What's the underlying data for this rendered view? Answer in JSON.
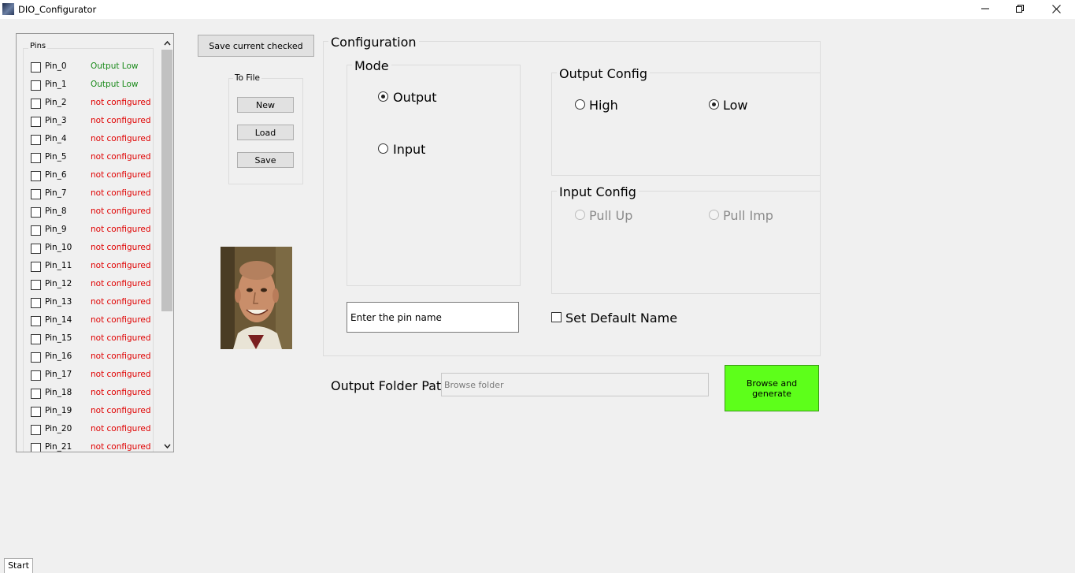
{
  "window": {
    "title": "DIO_Configurator",
    "minimize_glyph": "—",
    "maximize_icon": "restore-icon",
    "close_glyph": "✕"
  },
  "pins": {
    "legend": "Pins",
    "items": [
      {
        "name": "Pin_0",
        "status": "Output Low",
        "state": "ok"
      },
      {
        "name": "Pin_1",
        "status": "Output Low",
        "state": "ok"
      },
      {
        "name": "Pin_2",
        "status": "not configured",
        "state": "none"
      },
      {
        "name": "Pin_3",
        "status": "not configured",
        "state": "none"
      },
      {
        "name": "Pin_4",
        "status": "not configured",
        "state": "none"
      },
      {
        "name": "Pin_5",
        "status": "not configured",
        "state": "none"
      },
      {
        "name": "Pin_6",
        "status": "not configured",
        "state": "none"
      },
      {
        "name": "Pin_7",
        "status": "not configured",
        "state": "none"
      },
      {
        "name": "Pin_8",
        "status": "not configured",
        "state": "none"
      },
      {
        "name": "Pin_9",
        "status": "not configured",
        "state": "none"
      },
      {
        "name": "Pin_10",
        "status": "not configured",
        "state": "none"
      },
      {
        "name": "Pin_11",
        "status": "not configured",
        "state": "none"
      },
      {
        "name": "Pin_12",
        "status": "not configured",
        "state": "none"
      },
      {
        "name": "Pin_13",
        "status": "not configured",
        "state": "none"
      },
      {
        "name": "Pin_14",
        "status": "not configured",
        "state": "none"
      },
      {
        "name": "Pin_15",
        "status": "not configured",
        "state": "none"
      },
      {
        "name": "Pin_16",
        "status": "not configured",
        "state": "none"
      },
      {
        "name": "Pin_17",
        "status": "not configured",
        "state": "none"
      },
      {
        "name": "Pin_18",
        "status": "not configured",
        "state": "none"
      },
      {
        "name": "Pin_19",
        "status": "not configured",
        "state": "none"
      },
      {
        "name": "Pin_20",
        "status": "not configured",
        "state": "none"
      },
      {
        "name": "Pin_21",
        "status": "not configured",
        "state": "none"
      }
    ]
  },
  "actions": {
    "save_checked": "Save current checked",
    "to_file_legend": "To File",
    "new": "New",
    "load": "Load",
    "save": "Save"
  },
  "config": {
    "legend": "Configuration",
    "mode": {
      "legend": "Mode",
      "output": "Output",
      "input": "Input",
      "selected": "output"
    },
    "output_config": {
      "legend": "Output Config",
      "high": "High",
      "low": "Low",
      "selected": "low"
    },
    "input_config": {
      "legend": "Input Config",
      "pull_up": "Pull Up",
      "pull_imp": "Pull Imp"
    },
    "pin_name_value": "Enter the pin name",
    "set_default_name": "Set Default Name"
  },
  "output": {
    "folder_label": "Output Folder Path:",
    "folder_placeholder": "Browse folder",
    "generate_line1": "Browse and",
    "generate_line2": "generate"
  },
  "footer": {
    "start_tab": "Start"
  },
  "colors": {
    "status_ok": "#1a8a1a",
    "status_none": "#e00000",
    "generate_button": "#5dff1a"
  }
}
